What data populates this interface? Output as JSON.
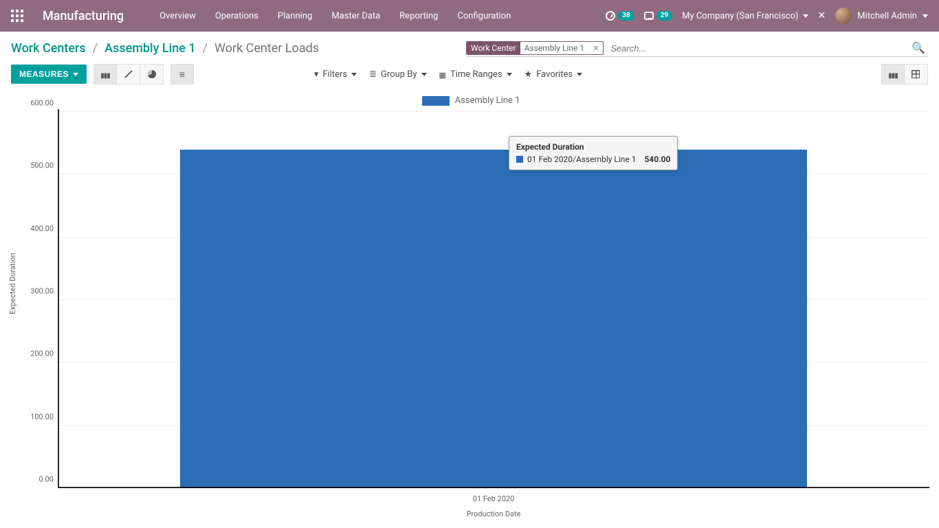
{
  "topbar": {
    "brand": "Manufacturing",
    "menu": [
      "Overview",
      "Operations",
      "Planning",
      "Master Data",
      "Reporting",
      "Configuration"
    ],
    "timer_badge": "38",
    "conversations_badge": "29",
    "company": "My Company (San Francisco)",
    "user_name": "Mitchell Admin"
  },
  "breadcrumb": {
    "a": "Work Centers",
    "b": "Assembly Line 1",
    "c": "Work Center Loads"
  },
  "search": {
    "facet_label": "Work Center",
    "facet_value": "Assembly Line 1",
    "placeholder": "Search..."
  },
  "toolbar": {
    "measures_label": "MEASURES",
    "filters_label": "Filters",
    "groupby_label": "Group By",
    "timeranges_label": "Time Ranges",
    "favorites_label": "Favorites"
  },
  "chart_data": {
    "type": "bar",
    "title": "",
    "legend": [
      "Assembly Line 1"
    ],
    "categories": [
      "01 Feb 2020"
    ],
    "series": [
      {
        "name": "Assembly Line 1",
        "values": [
          540.0
        ]
      }
    ],
    "xlabel": "Production Date",
    "ylabel": "Expected Duration",
    "ylim": [
      0,
      600
    ],
    "y_ticks": [
      "0.00",
      "100.00",
      "200.00",
      "300.00",
      "400.00",
      "500.00",
      "600.00"
    ]
  },
  "tooltip": {
    "title": "Expected Duration",
    "row_label": "01 Feb 2020/Assembly Line 1",
    "value": "540.00"
  }
}
